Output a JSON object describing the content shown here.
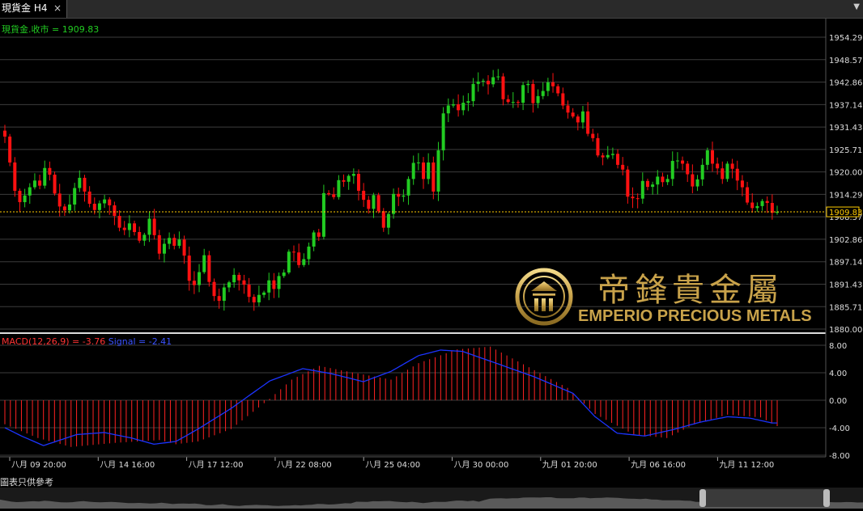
{
  "tab": {
    "title": "現貨金 H4",
    "close": "×"
  },
  "price_legend": "現貨金.收市 = 1909.83",
  "macd_legend": {
    "macd": "MACD(12,26,9) = -3.76",
    "signal": "Signal = -2.41"
  },
  "footer_note": "圖表只供參考",
  "logo": {
    "chinese": "帝鋒貴金屬",
    "english": "EMPERIO PRECIOUS METALS"
  },
  "colors": {
    "up": "#22cc22",
    "down": "#ff1111",
    "macd": "#ff2222",
    "signal": "#1c34ff",
    "price_line": "#ffcc00",
    "grid": "#3c3c3c",
    "gold": "#c8a24a"
  },
  "chart_data": [
    {
      "type": "candlestick",
      "series_name": "現貨金",
      "current_price": 1909.83,
      "y_ticks": [
        1954.29,
        1948.57,
        1942.86,
        1937.14,
        1931.43,
        1925.71,
        1920.0,
        1914.29,
        1908.57,
        1902.86,
        1897.14,
        1891.43,
        1885.71,
        1880.0
      ],
      "ylim": [
        1880.0,
        1954.29
      ],
      "x_tick_labels": [
        "八月 09 20:00",
        "八月 14 16:00",
        "八月 17 12:00",
        "八月 22 08:00",
        "八月 25 04:00",
        "八月 30 00:00",
        "九月 01 20:00",
        "九月 06 16:00",
        "九月 11 12:00"
      ],
      "grid": true,
      "closes": [
        1929.0,
        1922.4,
        1915.2,
        1912.3,
        1914.0,
        1916.1,
        1917.8,
        1916.5,
        1921.0,
        1919.3,
        1914.5,
        1911.2,
        1910.2,
        1911.7,
        1915.9,
        1918.5,
        1915.0,
        1911.9,
        1910.3,
        1912.0,
        1913.0,
        1911.5,
        1908.8,
        1905.8,
        1905.2,
        1906.9,
        1904.7,
        1902.5,
        1904.0,
        1908.1,
        1903.9,
        1899.2,
        1901.7,
        1903.2,
        1901.2,
        1902.8,
        1898.7,
        1892.3,
        1891.2,
        1894.5,
        1898.8,
        1892.0,
        1888.4,
        1887.2,
        1890.6,
        1891.9,
        1893.8,
        1892.4,
        1891.3,
        1888.2,
        1886.8,
        1888.7,
        1889.3,
        1892.4,
        1890.2,
        1893.5,
        1894.4,
        1899.7,
        1899.5,
        1896.3,
        1897.8,
        1901.0,
        1904.6,
        1903.5,
        1914.6,
        1914.3,
        1913.6,
        1917.9,
        1917.5,
        1919.0,
        1919.5,
        1915.2,
        1912.9,
        1910.6,
        1914.1,
        1910.0,
        1905.8,
        1909.3,
        1914.4,
        1913.7,
        1914.0,
        1918.2,
        1922.3,
        1922.4,
        1918.2,
        1922.4,
        1915.0,
        1925.5,
        1934.9,
        1936.9,
        1937.2,
        1935.7,
        1937.6,
        1938.0,
        1942.4,
        1943.0,
        1943.2,
        1942.3,
        1944.1,
        1944.3,
        1938.5,
        1937.8,
        1937.8,
        1937.6,
        1942.1,
        1942.4,
        1937.5,
        1939.3,
        1940.6,
        1942.8,
        1941.8,
        1940.0,
        1936.9,
        1935.1,
        1934.1,
        1932.6,
        1935.4,
        1929.7,
        1928.6,
        1924.2,
        1923.7,
        1924.3,
        1924.6,
        1921.8,
        1920.6,
        1913.7,
        1913.3,
        1913.2,
        1917.7,
        1916.2,
        1916.8,
        1918.8,
        1917.4,
        1918.2,
        1922.8,
        1922.9,
        1922.1,
        1919.4,
        1916.3,
        1918.1,
        1921.8,
        1925.5,
        1922.1,
        1920.9,
        1918.2,
        1922.1,
        1920.8,
        1917.8,
        1916.1,
        1912.2,
        1910.8,
        1911.3,
        1912.6,
        1912.1,
        1909.6,
        1909.83
      ],
      "macd_panel": {
        "macd_value": -3.76,
        "signal_value": -2.41,
        "y_ticks": [
          8.0,
          4.0,
          0.0,
          -4.0,
          -8.0
        ],
        "ylim": [
          -8.0,
          8.0
        ],
        "signal_line": [
          [
            0,
            -4.0
          ],
          [
            6,
            -5.2
          ],
          [
            14,
            -6.6
          ],
          [
            26,
            -5.0
          ],
          [
            36,
            -4.7
          ],
          [
            46,
            -5.5
          ],
          [
            54,
            -6.4
          ],
          [
            62,
            -6.0
          ],
          [
            70,
            -4.2
          ],
          [
            82,
            -1.2
          ],
          [
            96,
            2.8
          ],
          [
            108,
            4.6
          ],
          [
            118,
            3.9
          ],
          [
            130,
            2.7
          ],
          [
            140,
            4.2
          ],
          [
            150,
            6.5
          ],
          [
            158,
            7.3
          ],
          [
            166,
            7.1
          ],
          [
            178,
            5.4
          ],
          [
            192,
            3.4
          ],
          [
            206,
            1.0
          ],
          [
            214,
            -2.4
          ],
          [
            222,
            -4.8
          ],
          [
            232,
            -5.2
          ],
          [
            242,
            -4.3
          ],
          [
            252,
            -3.2
          ],
          [
            262,
            -2.4
          ],
          [
            270,
            -2.6
          ],
          [
            278,
            -3.3
          ]
        ],
        "macd_hist_segments": [
          [
            0,
            -3.5
          ],
          [
            12,
            -5.5
          ],
          [
            24,
            -6.8
          ],
          [
            40,
            -6.2
          ],
          [
            56,
            -5.8
          ],
          [
            62,
            -6.4
          ],
          [
            70,
            -6.0
          ],
          [
            82,
            -4.2
          ],
          [
            96,
            0.2
          ],
          [
            104,
            3.0
          ],
          [
            114,
            5.0
          ],
          [
            124,
            4.2
          ],
          [
            140,
            3.0
          ],
          [
            150,
            5.4
          ],
          [
            164,
            7.4
          ],
          [
            176,
            7.8
          ],
          [
            190,
            4.8
          ],
          [
            204,
            1.8
          ],
          [
            214,
            -2.0
          ],
          [
            228,
            -5.0
          ],
          [
            240,
            -5.5
          ],
          [
            250,
            -3.5
          ],
          [
            262,
            -2.1
          ],
          [
            274,
            -2.5
          ],
          [
            280,
            -3.76
          ]
        ]
      }
    }
  ]
}
